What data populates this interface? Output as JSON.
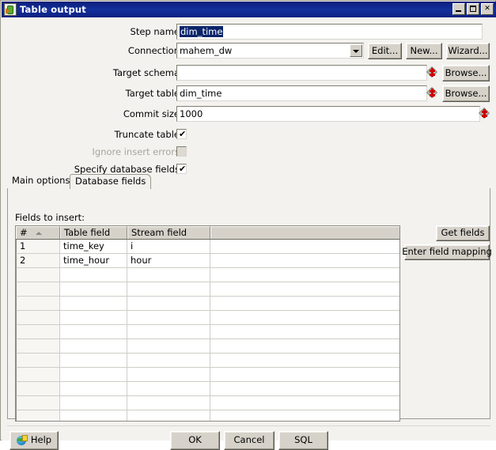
{
  "window": {
    "title": "Table output",
    "icon": "table-output-icon",
    "controls": {
      "minimize": "minimize-button",
      "maximize": "maximize-button",
      "close": "close-button",
      "close_glyph": "✕"
    }
  },
  "form": {
    "step_name": {
      "label": "Step name",
      "value": "dim_time",
      "selected": true
    },
    "connection": {
      "label": "Connection",
      "value": "mahem_dw",
      "options": [
        "mahem_dw"
      ],
      "edit_button": "Edit...",
      "new_button": "New...",
      "wizard_button": "Wizard..."
    },
    "target_schema": {
      "label": "Target schema",
      "value": "",
      "placeholder": "",
      "browse_button": "Browse..."
    },
    "target_table": {
      "label": "Target table",
      "value": "dim_time",
      "browse_button": "Browse..."
    },
    "commit_size": {
      "label": "Commit size",
      "value": "1000"
    },
    "truncate_table": {
      "label": "Truncate table",
      "checked": true,
      "check_glyph": "✔"
    },
    "ignore_insert_errors": {
      "label": "Ignore insert errors",
      "checked": false,
      "disabled": true
    },
    "specify_database_fields": {
      "label": "Specify database fields",
      "checked": true,
      "check_glyph": "✔"
    }
  },
  "tabs": {
    "items": [
      {
        "label": "Main options",
        "active": false
      },
      {
        "label": "Database fields",
        "active": true
      }
    ]
  },
  "fields_panel": {
    "heading": "Fields to insert:",
    "columns": [
      "#",
      "Table field",
      "Stream field",
      ""
    ],
    "sort_column": "#",
    "rows": [
      {
        "index": "1",
        "table_field": "time_key",
        "stream_field": "i",
        "extra": ""
      },
      {
        "index": "2",
        "table_field": "time_hour",
        "stream_field": "hour",
        "extra": ""
      }
    ],
    "empty_row_count": 12,
    "get_fields_button": "Get fields",
    "enter_field_mapping_button": "Enter field mapping"
  },
  "footer": {
    "help_button": "Help",
    "ok_button": "OK",
    "cancel_button": "Cancel",
    "sql_button": "SQL"
  },
  "colors": {
    "titlebar": "#15309c",
    "titlebar_text": "#ffffff",
    "dialog_bg": "#f3f2ef",
    "button_face": "#d6d2ca",
    "selection": "#0a246a",
    "marker_red": "#cc0000",
    "grid_header": "#d6d2ca"
  }
}
